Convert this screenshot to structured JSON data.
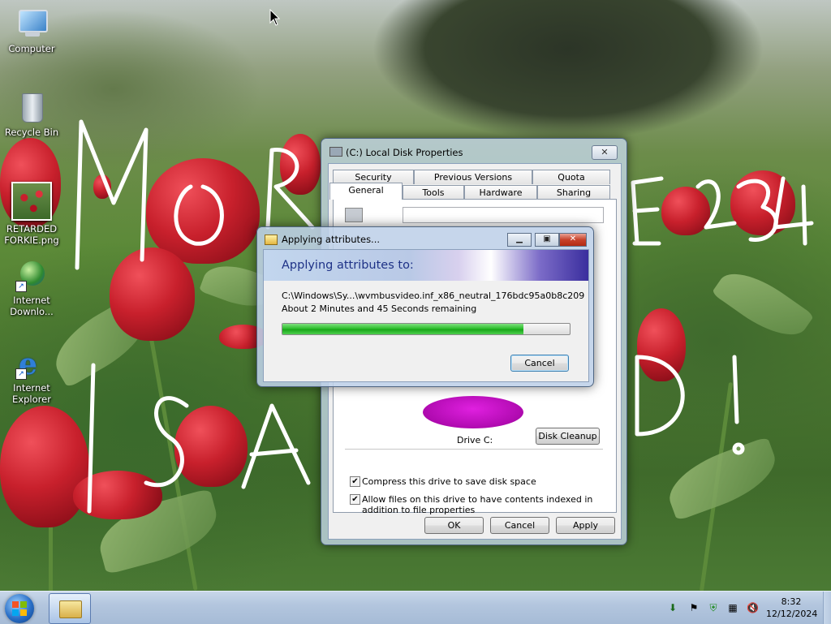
{
  "desktop": {
    "icons": [
      {
        "label": "Computer"
      },
      {
        "label": "Recycle Bin"
      },
      {
        "label": "RETARDED FORKIE.png"
      },
      {
        "label": "Internet Downlo..."
      },
      {
        "label": "Internet Explorer"
      }
    ],
    "graffiti": [
      "MOR",
      "E 1234",
      "ISA",
      "D!"
    ]
  },
  "properties": {
    "title": "(C:) Local Disk Properties",
    "close_label": "✕",
    "tabs_top": [
      "Security",
      "Previous Versions",
      "Quota"
    ],
    "tabs_bottom": [
      "General",
      "Tools",
      "Hardware",
      "Sharing"
    ],
    "active_tab": "General",
    "drive_label": "Drive C:",
    "disk_cleanup_label": "Disk Cleanup",
    "compress_label": "Compress this drive to save disk space",
    "index_label": "Allow files on this drive to have contents indexed in addition to file properties",
    "compress_checked": true,
    "index_checked": true,
    "ok_label": "OK",
    "cancel_label": "Cancel",
    "apply_label": "Apply"
  },
  "progress_dialog": {
    "title": "Applying attributes...",
    "heading": "Applying attributes to:",
    "path": "C:\\Windows\\Sy...\\wvmbusvideo.inf_x86_neutral_176bdc95a0b8c209",
    "remaining": "About 2 Minutes and 45 Seconds remaining",
    "progress_fraction": 0.84,
    "cancel_label": "Cancel",
    "progress_color": "#2fbf2f"
  },
  "taskbar": {
    "clock_time": "8:32",
    "clock_date": "12/12/2024",
    "tray_icons": [
      "network-download-icon",
      "action-center-flag-icon",
      "security-shield-icon",
      "network-icon",
      "volume-muted-icon"
    ]
  }
}
